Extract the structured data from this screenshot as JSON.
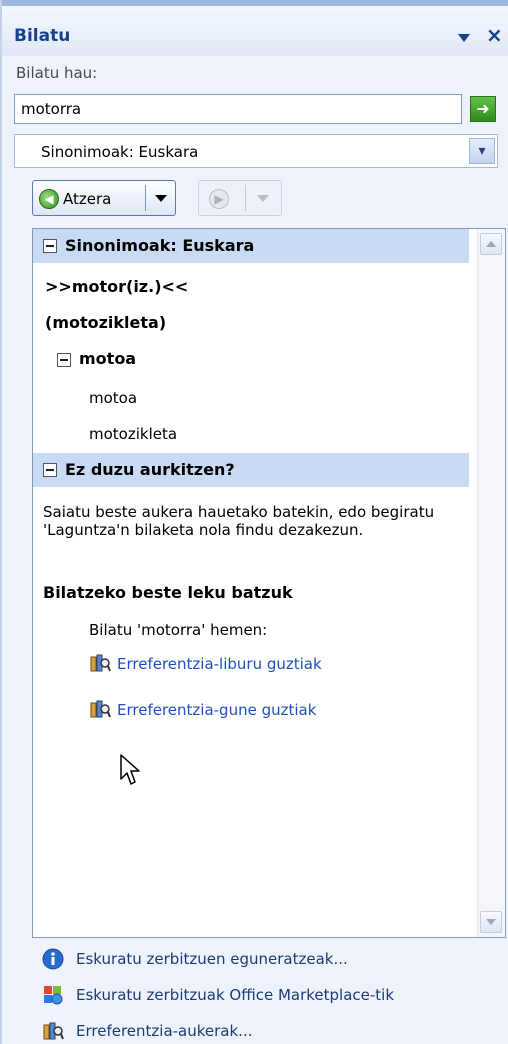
{
  "pane": {
    "title": "Bilatu",
    "close_glyph": "×"
  },
  "search": {
    "label": "Bilatu hau:",
    "value": "motorra",
    "go_glyph": "➜"
  },
  "reference": {
    "selected": "Sinonimoak: Euskara",
    "dropdown_glyph": "▾"
  },
  "nav": {
    "back_label": "Atzera",
    "back_glyph": "◀",
    "forward_glyph": "▶"
  },
  "results": {
    "section1": {
      "header": "Sinonimoak: Euskara",
      "headword": ">>motor(iz.)<<",
      "sense": "(motozikleta)",
      "group": {
        "title": "motoa",
        "items": [
          "motoa",
          "motozikleta"
        ]
      }
    },
    "section2": {
      "header": "Ez duzu aurkitzen?",
      "hint": "Saiatu beste aukera hauetako batekin, edo begiratu 'Laguntza'n bilaketa nola findu dezakezun.",
      "other_places_title": "Bilatzeko beste leku batzuk",
      "search_here": "Bilatu 'motorra' hemen:",
      "links": [
        "Erreferentzia-liburu guztiak",
        "Erreferentzia-gune guztiak"
      ]
    }
  },
  "footer": {
    "links": [
      "Eskuratu zerbitzuen eguneratzeak...",
      "Eskuratu zerbitzuak Office Marketplace-tik",
      "Erreferentzia-aukerak..."
    ]
  },
  "icons": {
    "info": "info-icon",
    "office": "office-marketplace-icon",
    "reference": "reference-books-icon",
    "go": "go-arrow-icon",
    "back": "back-arrow-icon",
    "forward": "forward-arrow-icon"
  },
  "colors": {
    "pane_bg": "#eef3fb",
    "title": "#15428b",
    "section_header": "#c9daf3",
    "link": "#1f4fbf"
  }
}
